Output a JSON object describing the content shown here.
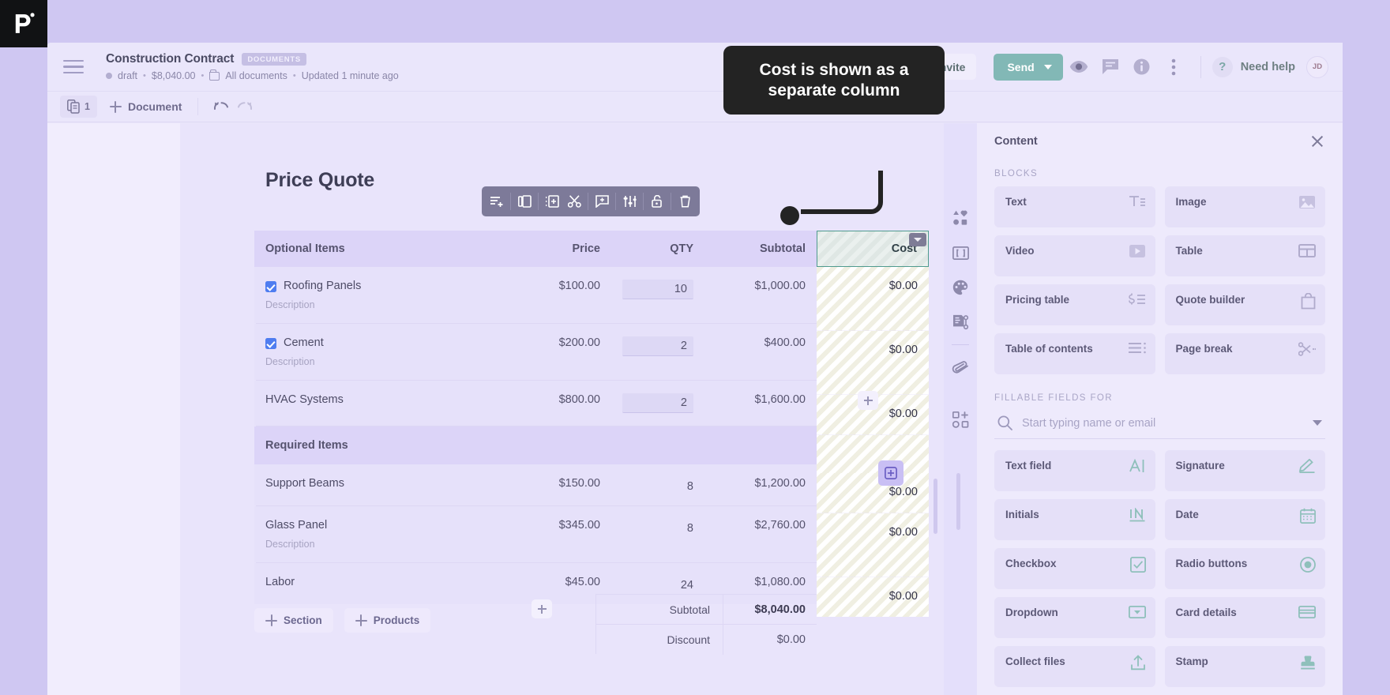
{
  "brand": {
    "name": "pd-logo"
  },
  "topbar": {
    "doc_title": "Construction Contract",
    "doc_tag": "DOCUMENTS",
    "status": "draft",
    "amount": "$8,040.00",
    "folder": "All documents",
    "updated": "Updated 1 minute ago",
    "invite_label": "Invite",
    "send_label": "Send",
    "need_help_label": "Need help",
    "avatar_initials": "JD"
  },
  "subbar": {
    "page_count": "1",
    "add_document_label": "Document"
  },
  "document": {
    "quote_title": "Price Quote",
    "table": {
      "columns": [
        "Optional Items",
        "Price",
        "QTY",
        "Subtotal"
      ],
      "cost_column": "Cost",
      "sections": [
        {
          "header": "Optional Items",
          "rows": [
            {
              "name": "Roofing Panels",
              "description": "Description",
              "price": "$100.00",
              "qty": "10",
              "subtotal": "$1,000.00",
              "cost": "$0.00",
              "checked": true,
              "qty_input": true
            },
            {
              "name": "Cement",
              "description": "Description",
              "price": "$200.00",
              "qty": "2",
              "subtotal": "$400.00",
              "cost": "$0.00",
              "checked": true,
              "qty_input": true
            },
            {
              "name": "HVAC Systems",
              "description": "",
              "price": "$800.00",
              "qty": "2",
              "subtotal": "$1,600.00",
              "cost": "$0.00",
              "checked": false,
              "qty_input": true
            }
          ]
        },
        {
          "header": "Required Items",
          "rows": [
            {
              "name": "Support Beams",
              "description": "",
              "price": "$150.00",
              "qty": "8",
              "subtotal": "$1,200.00",
              "cost": "$0.00",
              "checked": false,
              "qty_input": false
            },
            {
              "name": "Glass Panel",
              "description": "Description",
              "price": "$345.00",
              "qty": "8",
              "subtotal": "$2,760.00",
              "cost": "$0.00",
              "checked": false,
              "qty_input": false
            },
            {
              "name": "Labor",
              "description": "",
              "price": "$45.00",
              "qty": "24",
              "subtotal": "$1,080.00",
              "cost": "$0.00",
              "checked": false,
              "qty_input": false
            }
          ]
        }
      ],
      "totals": [
        {
          "label": "Subtotal",
          "value": "$8,040.00",
          "bold": true
        },
        {
          "label": "Discount",
          "value": "$0.00",
          "bold": false
        }
      ]
    },
    "add_section_label": "Section",
    "add_products_label": "Products"
  },
  "callout": {
    "text": "Cost is shown as a separate column"
  },
  "panel": {
    "title": "Content",
    "blocks_label": "BLOCKS",
    "blocks": [
      {
        "label": "Text",
        "icon": "text-icon"
      },
      {
        "label": "Image",
        "icon": "image-icon"
      },
      {
        "label": "Video",
        "icon": "video-icon"
      },
      {
        "label": "Table",
        "icon": "table-icon"
      },
      {
        "label": "Pricing table",
        "icon": "pricing-table-icon"
      },
      {
        "label": "Quote builder",
        "icon": "quote-builder-icon"
      },
      {
        "label": "Table of contents",
        "icon": "table-of-contents-icon"
      },
      {
        "label": "Page break",
        "icon": "page-break-icon"
      }
    ],
    "fillable_label": "FILLABLE FIELDS FOR",
    "search_placeholder": "Start typing name or email",
    "fields": [
      {
        "label": "Text field",
        "icon": "text-field-icon"
      },
      {
        "label": "Signature",
        "icon": "signature-icon"
      },
      {
        "label": "Initials",
        "icon": "initials-icon"
      },
      {
        "label": "Date",
        "icon": "date-icon"
      },
      {
        "label": "Checkbox",
        "icon": "checkbox-icon"
      },
      {
        "label": "Radio buttons",
        "icon": "radio-buttons-icon"
      },
      {
        "label": "Dropdown",
        "icon": "dropdown-icon"
      },
      {
        "label": "Card details",
        "icon": "card-details-icon"
      },
      {
        "label": "Collect files",
        "icon": "collect-files-icon"
      },
      {
        "label": "Stamp",
        "icon": "stamp-icon"
      }
    ]
  },
  "colors": {
    "accent_teal": "#82b8b6",
    "selection_green": "#4f9b8e",
    "page_bg": "#e9e4fb",
    "panel_bg": "#eeeafc",
    "callout_bg": "#232323"
  }
}
